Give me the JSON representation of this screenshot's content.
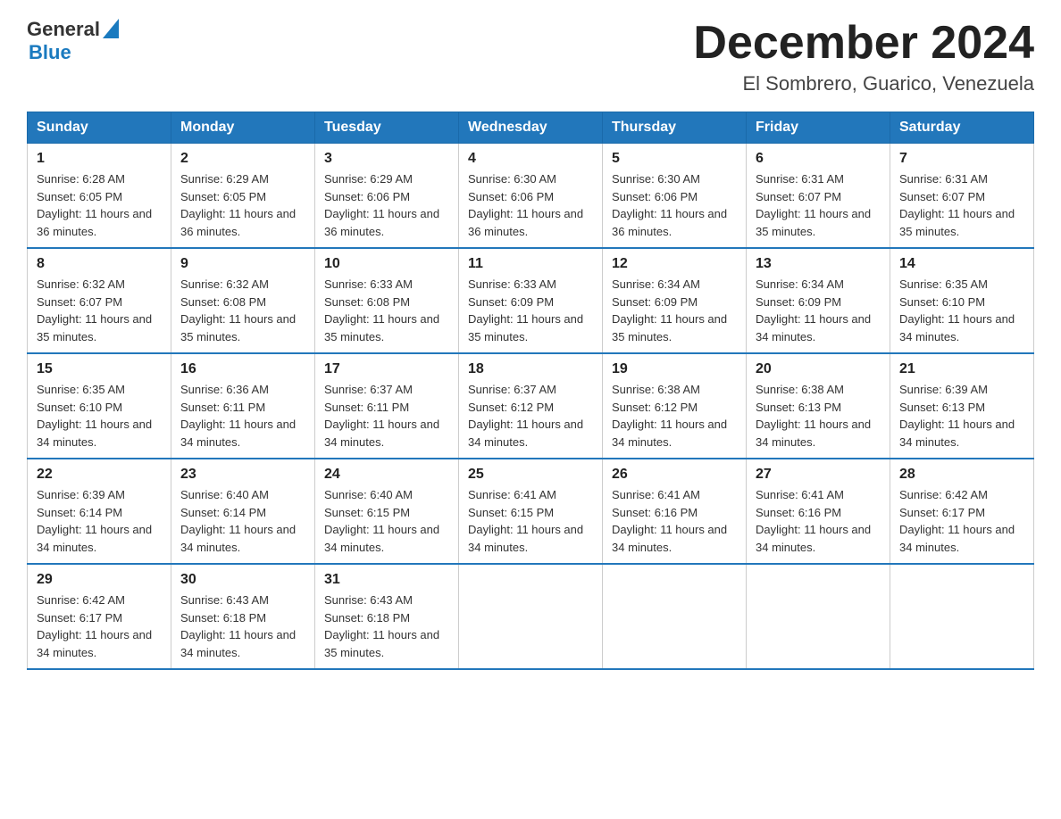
{
  "header": {
    "logo_text_general": "General",
    "logo_text_blue": "Blue",
    "month_title": "December 2024",
    "location": "El Sombrero, Guarico, Venezuela"
  },
  "days_of_week": [
    "Sunday",
    "Monday",
    "Tuesday",
    "Wednesday",
    "Thursday",
    "Friday",
    "Saturday"
  ],
  "weeks": [
    [
      {
        "day": "1",
        "sunrise": "6:28 AM",
        "sunset": "6:05 PM",
        "daylight": "11 hours and 36 minutes."
      },
      {
        "day": "2",
        "sunrise": "6:29 AM",
        "sunset": "6:05 PM",
        "daylight": "11 hours and 36 minutes."
      },
      {
        "day": "3",
        "sunrise": "6:29 AM",
        "sunset": "6:06 PM",
        "daylight": "11 hours and 36 minutes."
      },
      {
        "day": "4",
        "sunrise": "6:30 AM",
        "sunset": "6:06 PM",
        "daylight": "11 hours and 36 minutes."
      },
      {
        "day": "5",
        "sunrise": "6:30 AM",
        "sunset": "6:06 PM",
        "daylight": "11 hours and 36 minutes."
      },
      {
        "day": "6",
        "sunrise": "6:31 AM",
        "sunset": "6:07 PM",
        "daylight": "11 hours and 35 minutes."
      },
      {
        "day": "7",
        "sunrise": "6:31 AM",
        "sunset": "6:07 PM",
        "daylight": "11 hours and 35 minutes."
      }
    ],
    [
      {
        "day": "8",
        "sunrise": "6:32 AM",
        "sunset": "6:07 PM",
        "daylight": "11 hours and 35 minutes."
      },
      {
        "day": "9",
        "sunrise": "6:32 AM",
        "sunset": "6:08 PM",
        "daylight": "11 hours and 35 minutes."
      },
      {
        "day": "10",
        "sunrise": "6:33 AM",
        "sunset": "6:08 PM",
        "daylight": "11 hours and 35 minutes."
      },
      {
        "day": "11",
        "sunrise": "6:33 AM",
        "sunset": "6:09 PM",
        "daylight": "11 hours and 35 minutes."
      },
      {
        "day": "12",
        "sunrise": "6:34 AM",
        "sunset": "6:09 PM",
        "daylight": "11 hours and 35 minutes."
      },
      {
        "day": "13",
        "sunrise": "6:34 AM",
        "sunset": "6:09 PM",
        "daylight": "11 hours and 34 minutes."
      },
      {
        "day": "14",
        "sunrise": "6:35 AM",
        "sunset": "6:10 PM",
        "daylight": "11 hours and 34 minutes."
      }
    ],
    [
      {
        "day": "15",
        "sunrise": "6:35 AM",
        "sunset": "6:10 PM",
        "daylight": "11 hours and 34 minutes."
      },
      {
        "day": "16",
        "sunrise": "6:36 AM",
        "sunset": "6:11 PM",
        "daylight": "11 hours and 34 minutes."
      },
      {
        "day": "17",
        "sunrise": "6:37 AM",
        "sunset": "6:11 PM",
        "daylight": "11 hours and 34 minutes."
      },
      {
        "day": "18",
        "sunrise": "6:37 AM",
        "sunset": "6:12 PM",
        "daylight": "11 hours and 34 minutes."
      },
      {
        "day": "19",
        "sunrise": "6:38 AM",
        "sunset": "6:12 PM",
        "daylight": "11 hours and 34 minutes."
      },
      {
        "day": "20",
        "sunrise": "6:38 AM",
        "sunset": "6:13 PM",
        "daylight": "11 hours and 34 minutes."
      },
      {
        "day": "21",
        "sunrise": "6:39 AM",
        "sunset": "6:13 PM",
        "daylight": "11 hours and 34 minutes."
      }
    ],
    [
      {
        "day": "22",
        "sunrise": "6:39 AM",
        "sunset": "6:14 PM",
        "daylight": "11 hours and 34 minutes."
      },
      {
        "day": "23",
        "sunrise": "6:40 AM",
        "sunset": "6:14 PM",
        "daylight": "11 hours and 34 minutes."
      },
      {
        "day": "24",
        "sunrise": "6:40 AM",
        "sunset": "6:15 PM",
        "daylight": "11 hours and 34 minutes."
      },
      {
        "day": "25",
        "sunrise": "6:41 AM",
        "sunset": "6:15 PM",
        "daylight": "11 hours and 34 minutes."
      },
      {
        "day": "26",
        "sunrise": "6:41 AM",
        "sunset": "6:16 PM",
        "daylight": "11 hours and 34 minutes."
      },
      {
        "day": "27",
        "sunrise": "6:41 AM",
        "sunset": "6:16 PM",
        "daylight": "11 hours and 34 minutes."
      },
      {
        "day": "28",
        "sunrise": "6:42 AM",
        "sunset": "6:17 PM",
        "daylight": "11 hours and 34 minutes."
      }
    ],
    [
      {
        "day": "29",
        "sunrise": "6:42 AM",
        "sunset": "6:17 PM",
        "daylight": "11 hours and 34 minutes."
      },
      {
        "day": "30",
        "sunrise": "6:43 AM",
        "sunset": "6:18 PM",
        "daylight": "11 hours and 34 minutes."
      },
      {
        "day": "31",
        "sunrise": "6:43 AM",
        "sunset": "6:18 PM",
        "daylight": "11 hours and 35 minutes."
      },
      null,
      null,
      null,
      null
    ]
  ],
  "labels": {
    "sunrise_label": "Sunrise:",
    "sunset_label": "Sunset:",
    "daylight_label": "Daylight:"
  }
}
